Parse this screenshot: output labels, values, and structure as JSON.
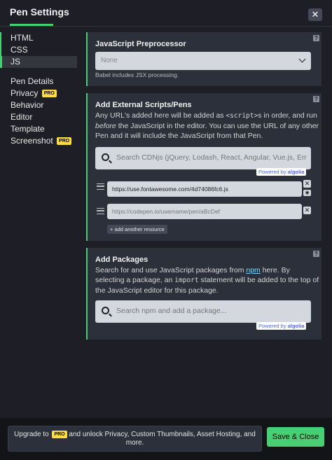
{
  "header": {
    "title": "Pen Settings",
    "close_icon": "close-icon"
  },
  "sidebar": {
    "items": [
      {
        "label": "HTML"
      },
      {
        "label": "CSS"
      },
      {
        "label": "JS"
      },
      {
        "label": "Pen Details"
      },
      {
        "label": "Privacy",
        "badge": "PRO"
      },
      {
        "label": "Behavior"
      },
      {
        "label": "Editor"
      },
      {
        "label": "Template"
      },
      {
        "label": "Screenshot",
        "badge": "PRO"
      }
    ]
  },
  "preprocessor": {
    "title": "JavaScript Preprocessor",
    "selected": "None",
    "hint": "Babel includes JSX processing.",
    "help": "?"
  },
  "external": {
    "title": "Add External Scripts/Pens",
    "desc_1": "Any URL's added here will be added as ",
    "desc_code": "<script>",
    "desc_2": "s in order, and run ",
    "desc_em": "before",
    "desc_3": " the JavaScript in the editor. You can use the URL of any other Pen and it will include the JavaScript from that Pen.",
    "search_placeholder": "Search CDNjs (jQuery, Lodash, React, Angular, Vue.js, Ember...",
    "powered_by": "Powered by",
    "algolia": "algolia",
    "resources": [
      {
        "value": "https://use.fontawesome.com/4d74086fc6.js"
      },
      {
        "placeholder": "https://codepen.io/username/pen/aBcDef"
      }
    ],
    "add_resource": "+ add another resource",
    "help": "?"
  },
  "packages": {
    "title": "Add Packages",
    "desc_1": "Search for and use JavaScript packages from ",
    "desc_link": "npm",
    "desc_2": " here. By selecting a package, an ",
    "desc_code": "import",
    "desc_3": " statement will be added to the top of the JavaScript editor for this package.",
    "search_placeholder": "Search npm and add a package...",
    "powered_by": "Powered by",
    "algolia": "algolia",
    "help": "?"
  },
  "footer": {
    "upgrade_1": "Upgrade to",
    "upgrade_badge": "PRO",
    "upgrade_2": "and unlock Privacy, Custom Thumbnails, Asset Hosting, and",
    "upgrade_3": "more.",
    "save": "Save & Close"
  },
  "colors": {
    "accent": "#47cf73",
    "pro": "#ffdd40",
    "panel": "#2c303a",
    "background": "#1e1f26"
  }
}
